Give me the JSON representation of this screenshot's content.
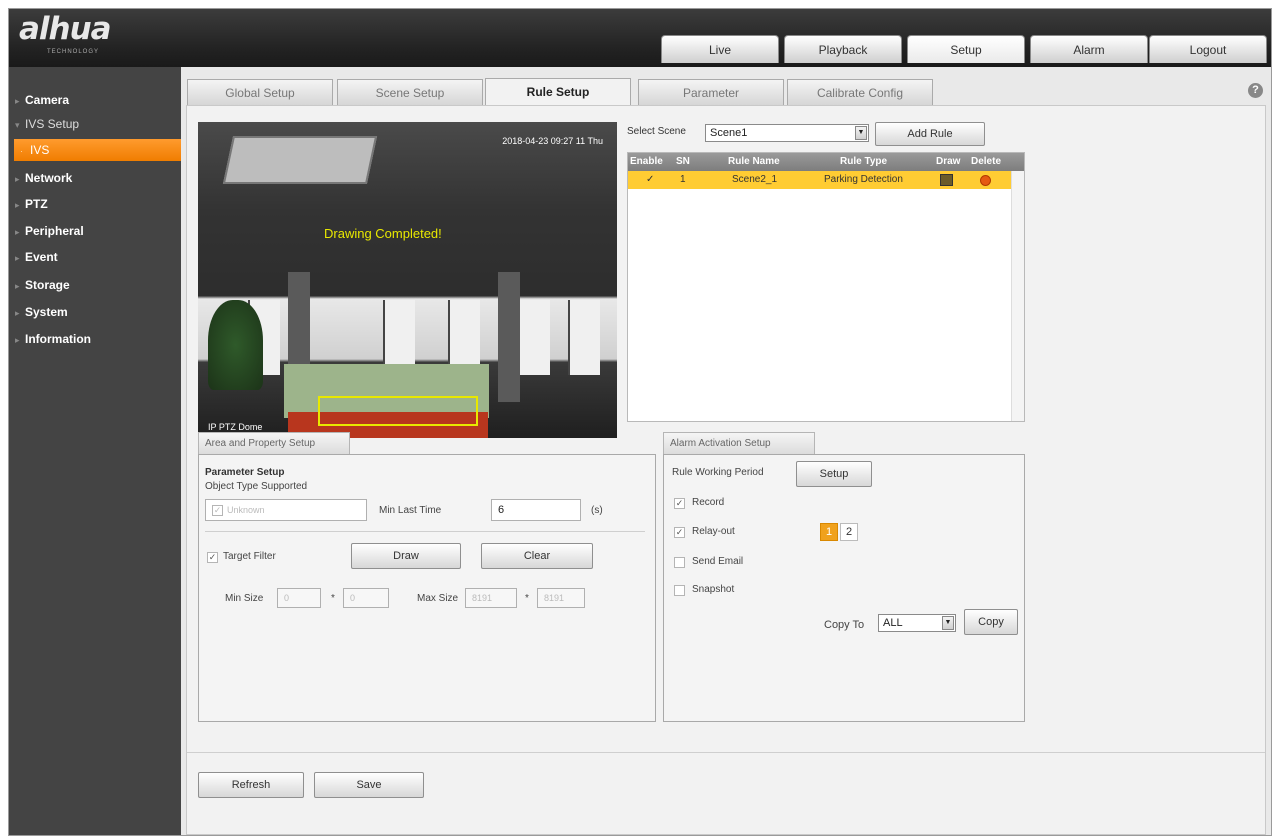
{
  "brand": {
    "logo": "alhua",
    "logo_sub": "TECHNOLOGY"
  },
  "top_nav": [
    "Live",
    "Playback",
    "Setup",
    "Alarm",
    "Logout"
  ],
  "top_nav_active": "Setup",
  "sidebar": {
    "items": [
      {
        "label": "Camera",
        "type": "main"
      },
      {
        "label": "IVS Setup",
        "type": "sub"
      },
      {
        "label": "IVS",
        "type": "active"
      },
      {
        "label": "Network",
        "type": "main"
      },
      {
        "label": "PTZ",
        "type": "main"
      },
      {
        "label": "Peripheral",
        "type": "main"
      },
      {
        "label": "Event",
        "type": "main"
      },
      {
        "label": "Storage",
        "type": "main"
      },
      {
        "label": "System",
        "type": "main"
      },
      {
        "label": "Information",
        "type": "main"
      }
    ]
  },
  "sub_tabs": [
    "Global Setup",
    "Scene Setup",
    "Rule Setup",
    "Parameter",
    "Calibrate Config"
  ],
  "sub_tab_active": "Rule Setup",
  "help_icon": "?",
  "video": {
    "timestamp": "2018-04-23 09:27 11 Thu",
    "overlay_message": "Drawing Completed!",
    "channel_name": "IP PTZ Dome"
  },
  "scene": {
    "label": "Select Scene",
    "value": "Scene1",
    "add_rule_label": "Add Rule"
  },
  "rule_table": {
    "headers": [
      "Enable",
      "SN",
      "Rule Name",
      "Rule Type",
      "Draw",
      "Delete"
    ],
    "rows": [
      {
        "enabled": "✓",
        "sn": "1",
        "name": "Scene2_1",
        "type": "Parking Detection"
      }
    ]
  },
  "area_setup": {
    "tab_label": "Area and Property Setup",
    "param_title": "Parameter Setup",
    "object_type_label": "Object Type Supported",
    "object_type_value": "Unknown",
    "min_last_time_label": "Min Last Time",
    "min_last_time_value": "6",
    "min_last_time_unit": "(s)",
    "target_filter_label": "Target Filter",
    "draw_label": "Draw",
    "clear_label": "Clear",
    "min_size_label": "Min Size",
    "min_size_w": "0",
    "min_size_h": "0",
    "max_size_label": "Max Size",
    "max_size_w": "8191",
    "max_size_h": "8191",
    "times": "*"
  },
  "alarm_setup": {
    "tab_label": "Alarm Activation Setup",
    "working_period_label": "Rule Working Period",
    "setup_label": "Setup",
    "record_label": "Record",
    "relay_out_label": "Relay-out",
    "relay_channels": [
      "1",
      "2"
    ],
    "send_email_label": "Send Email",
    "snapshot_label": "Snapshot",
    "copy_to_label": "Copy To",
    "copy_to_value": "ALL",
    "copy_label": "Copy"
  },
  "footer": {
    "refresh_label": "Refresh",
    "save_label": "Save"
  },
  "colors": {
    "accent": "#f07d00",
    "row_highlight": "#ffcc33",
    "sidebar_bg": "#444444"
  }
}
